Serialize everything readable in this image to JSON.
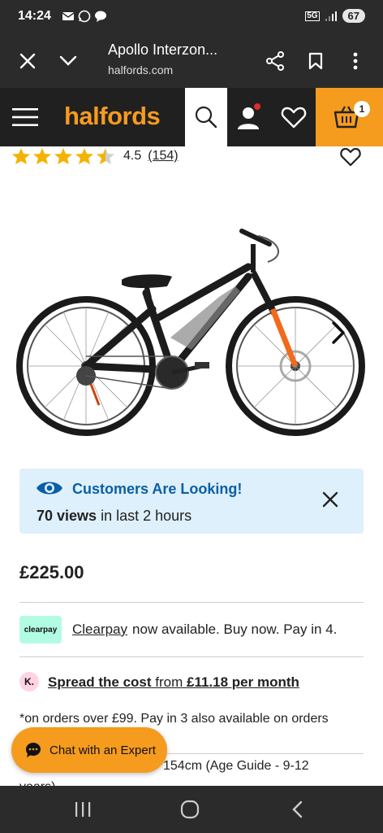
{
  "status_bar": {
    "time": "14:24",
    "network": "5G",
    "battery": "67",
    "icons": [
      "message-icon",
      "whatsapp-icon",
      "chat-icon",
      "network-icon",
      "signal-icon",
      "battery-icon"
    ]
  },
  "browser": {
    "page_title": "Apollo Interzon...",
    "domain": "halfords.com",
    "icons": [
      "close-icon",
      "chevron-down-icon",
      "share-icon",
      "bookmark-icon",
      "more-icon"
    ]
  },
  "header": {
    "logo": "halfords",
    "basket_count": "1",
    "accent_color": "#f59b1e",
    "icons": [
      "hamburger-icon",
      "search-icon",
      "account-icon",
      "heart-icon",
      "basket-icon"
    ]
  },
  "rating": {
    "stars": 4.5,
    "value": "4.5",
    "count": "(154)"
  },
  "product": {
    "image_name": "bike-image"
  },
  "looking": {
    "title": "Customers Are Looking!",
    "views_bold": "70 views",
    "views_rest": " in last 2 hours",
    "icons": [
      "eye-icon",
      "close-icon"
    ]
  },
  "price": "£225.00",
  "clearpay": {
    "badge": "clearpay",
    "link": "Clearpay",
    "text": "now available. Buy now. Pay in 4."
  },
  "klarna": {
    "badge": "K.",
    "link_bold": "Spread the cost",
    "link_mid": " from ",
    "link_amount": "£11.18 per month"
  },
  "orders_note": "*on orders over £99. Pay in 3 also available on orders",
  "height_text": "154cm (Age Guide - 9-12",
  "height_text_2": "years)",
  "chat": {
    "label": "Chat with an Expert"
  },
  "nav": {
    "icons": [
      "recent-apps-icon",
      "home-icon",
      "back-icon"
    ]
  }
}
